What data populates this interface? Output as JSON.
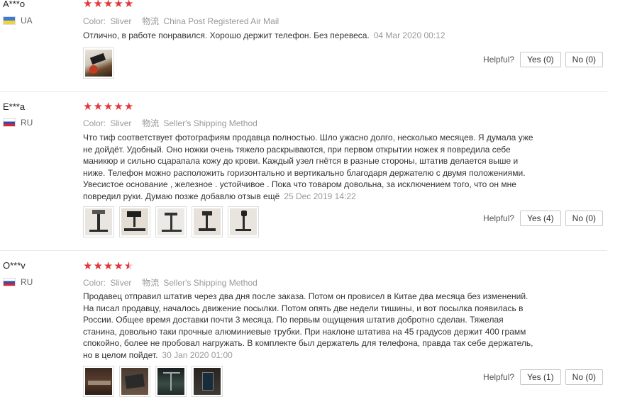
{
  "reviews": [
    {
      "user": "A***o",
      "country": "UA",
      "color_label": "Color:",
      "color_value": "Sliver",
      "shipping_label": "物流",
      "shipping_value": "China Post Registered Air Mail",
      "text": "Отлично, в работе понравился. Хорошо держит телефон. Без перевеса.",
      "date": "04 Mar 2020 00:12",
      "rating": 5,
      "photo_count": 1,
      "helpful_label": "Helpful?",
      "yes_label": "Yes (0)",
      "no_label": "No (0)"
    },
    {
      "user": "E***a",
      "country": "RU",
      "color_label": "Color:",
      "color_value": "Sliver",
      "shipping_label": "物流",
      "shipping_value": "Seller's Shipping Method",
      "text": "Что тиф соответствует фотографиям продавца полностью. Шло ужасно долго, несколько месяцев. Я думала уже не дойдёт. Удобный. Оно ножки очень тяжело раскрываются, при первом открытии ножек я повредила себе маникюр и сильно сцарапала кожу до крови. Каждый узел гнётся в разные стороны, штатив делается выше и ниже. Телефон можно расположить горизонтально и вертикально благодаря держателю с двумя положениями. Увесистое основание , железное . устойчивое . Пока что товаром довольна, за исключением того, что он мне повредил руки. Думаю позже добавлю отзыв ещё",
      "date": "25 Dec 2019 14:22",
      "rating": 5,
      "photo_count": 5,
      "helpful_label": "Helpful?",
      "yes_label": "Yes (4)",
      "no_label": "No (0)"
    },
    {
      "user": "O***v",
      "country": "RU",
      "color_label": "Color:",
      "color_value": "Sliver",
      "shipping_label": "物流",
      "shipping_value": "Seller's Shipping Method",
      "text": "Продавец отправил штатив через два дня после заказа. Потом он провисел в Китае два месяца без изменений. На писал продавцу, началось движение посылки. Потом опять две недели тишины, и вот посылка появилась в России. Общее время доставки почти 3 месяца. По первым ощущения штатив добротно сделан. Тяжелая станина, довольно таки прочные алюминиевые трубки. При наклоне штатива на 45 градусов держит 400 грамм спокойно, более не пробовал нагружать. В комплекте был держатель для телефона, правда так себе держатель, но в целом пойдет.",
      "date": "30 Jan 2020 01:00",
      "rating": 4.5,
      "photo_count": 4,
      "helpful_label": "Helpful?",
      "yes_label": "Yes (1)",
      "no_label": "No (0)"
    }
  ]
}
